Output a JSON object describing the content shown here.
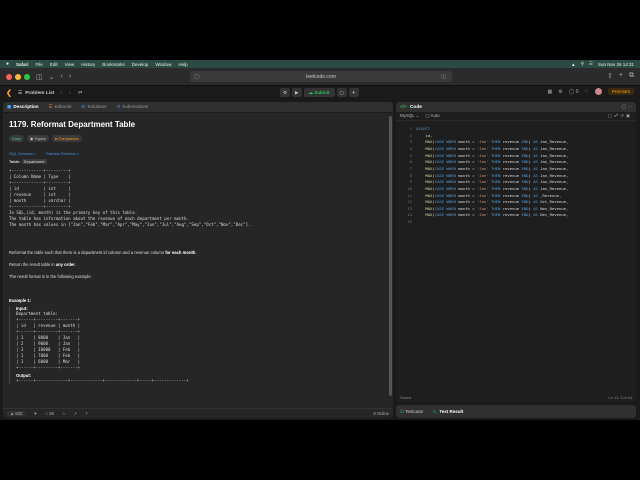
{
  "menubar": {
    "apple": "",
    "app": "Safari",
    "items": [
      "File",
      "Edit",
      "View",
      "History",
      "Bookmarks",
      "Develop",
      "Window",
      "Help"
    ],
    "clock": "Sun Nov 26 14:31"
  },
  "safari": {
    "url": "leetcode.com"
  },
  "lcnav": {
    "problem_list": "Problem List",
    "submit": "Submit",
    "streak": "0",
    "premium": "Premium"
  },
  "left": {
    "tabs": [
      "Description",
      "Editorial",
      "Solutions",
      "Submissions"
    ],
    "title": "1179. Reformat Department Table",
    "tags": [
      "Easy",
      "Topics",
      "Companies"
    ],
    "schema_links": [
      "SQL Schema >",
      "Pandas Schema >"
    ],
    "table_label": "Table:",
    "table_name": "Department",
    "schema_ascii": "+-------------+---------+\n| Column Name | Type    |\n+-------------+---------+\n| id          | int     |\n| revenue     | int     |\n| month       | varchar |\n+-------------+---------+",
    "schema_note": "In SQL,(id, month) is the primary key of this table.\nThe table has information about the revenue of each department per month.\nThe month has values in [\"Jan\",\"Feb\",\"Mar\",\"Apr\",\"May\",\"Jun\",\"Jul\",\"Aug\",\"Sep\",\"Oct\",\"Nov\",\"Dec\"].",
    "para1_pre": "Reformat the table such that there is a department id column and a revenue column ",
    "para1_bold": "for each month",
    "para1_post": ".",
    "para2_pre": "Return the result table in ",
    "para2_bold": "any order",
    "para2_post": ".",
    "para3": "The result format is in the following example.",
    "example_title": "Example 1:",
    "input_label": "Input:",
    "input_table_name": "Department table:",
    "input_ascii": "+------+---------+-------+\n| id   | revenue | month |\n+------+---------+-------+\n| 1    | 8000    | Jan   |\n| 2    | 9000    | Jan   |\n| 3    | 10000   | Feb   |\n| 1    | 7000    | Feb   |\n| 1    | 6000    | Mar   |\n+------+---------+-------+",
    "output_label": "Output:",
    "output_ascii": "+------+-------------+-------------+-------------+-----+-------------+",
    "footer": {
      "likes": "632",
      "comments": "38",
      "online": "8 Online"
    }
  },
  "code": {
    "title": "Code",
    "language": "MySQL",
    "mode": "Auto",
    "lines": [
      {
        "n": "1",
        "t": "SELECT"
      },
      {
        "n": "2",
        "t": "    id,"
      },
      {
        "n": "3",
        "t": "    MAX(CASE WHEN month = 'Jan' THEN revenue END) AS Jan_Revenue,"
      },
      {
        "n": "4",
        "t": "    MAX(CASE WHEN month = 'Jan' THEN revenue END) AS Jan_Revenue,"
      },
      {
        "n": "5",
        "t": "    MAX(CASE WHEN month = 'Jan' THEN revenue END) AS Jan_Revenue,"
      },
      {
        "n": "6",
        "t": "    MAX(CASE WHEN month = 'Jan' THEN revenue END) AS Jan_Revenue,"
      },
      {
        "n": "7",
        "t": "    MAX(CASE WHEN month = 'Jan' THEN revenue END) AS Jan_Revenue,"
      },
      {
        "n": "8",
        "t": "    MAX(CASE WHEN month = 'Jan' THEN revenue END) AS Jan_Revenue,"
      },
      {
        "n": "9",
        "t": "    MAX(CASE WHEN month = 'Jan' THEN revenue END) AS Jan_Revenue,"
      },
      {
        "n": "10",
        "t": "    MAX(CASE WHEN month = 'Jan' THEN revenue END) AS Jan_Revenue,"
      },
      {
        "n": "11",
        "t": "    MAX(CASE WHEN month = 'Jan' THEN revenue END) AS _Revenue,"
      },
      {
        "n": "12",
        "t": "    MAX(CASE WHEN month = 'Jan' THEN revenue END) AS Oct_Revenue,"
      },
      {
        "n": "13",
        "t": "    MAX(CASE WHEN month = 'Jan' THEN revenue END) AS Nov_Revenue,"
      },
      {
        "n": "14",
        "t": "    MAX(CASE WHEN month = 'Jan' THEN revenue END) AS Dec_Revenue,"
      },
      {
        "n": "15",
        "t": ""
      }
    ],
    "status": "Saved",
    "cursor": "Ln 11, Col 54"
  },
  "testbar": {
    "testcase": "Testcase",
    "result": "Test Result"
  }
}
